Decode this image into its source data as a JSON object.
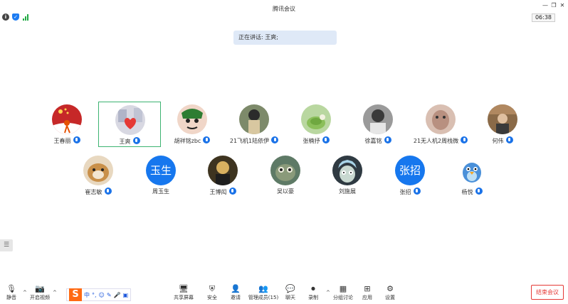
{
  "window": {
    "title": "腾讯会议"
  },
  "status": {
    "timer": "06:38"
  },
  "banner": {
    "text": "正在讲话: 王爽;"
  },
  "participants": [
    {
      "name": "王春丽",
      "avatar": "photo",
      "color": "#c62828",
      "active": false
    },
    {
      "name": "王爽",
      "avatar": "photo",
      "color": "#c9c9d6",
      "active": true
    },
    {
      "name": "胡祥铭zbc",
      "avatar": "photo",
      "color": "#d8a48f",
      "active": false
    },
    {
      "name": "21飞机1陆依伊",
      "avatar": "photo",
      "color": "#8a8a70",
      "active": false
    },
    {
      "name": "张楠抒",
      "avatar": "photo",
      "color": "#a6c98a",
      "active": false
    },
    {
      "name": "徐嘉铭",
      "avatar": "photo",
      "color": "#7a7a7a",
      "active": false
    },
    {
      "name": "21无人机2周栈微",
      "avatar": "photo",
      "color": "#c8a89a",
      "active": false
    },
    {
      "name": "何伟",
      "avatar": "photo",
      "color": "#9e7a52",
      "active": false
    },
    {
      "name": "崔志敏",
      "avatar": "photo",
      "color": "#caa070",
      "active": false
    },
    {
      "name": "周玉生",
      "avatar": "text",
      "initials": "玉生",
      "color": "#1677ee",
      "active": false
    },
    {
      "name": "王博闳",
      "avatar": "photo",
      "color": "#5a4a2a",
      "active": false
    },
    {
      "name": "吴以豪",
      "avatar": "photo",
      "color": "#6b8a6a",
      "active": false
    },
    {
      "name": "刘施展",
      "avatar": "photo",
      "color": "#44505a",
      "active": false
    },
    {
      "name": "张招",
      "avatar": "text",
      "initials": "张招",
      "color": "#1677ee",
      "active": false
    },
    {
      "name": "杨悦",
      "avatar": "photo",
      "color": "#ffffff",
      "active": false
    }
  ],
  "toolbar": {
    "mute": "静音",
    "video": "开启视频",
    "share": "共享屏幕",
    "security": "安全",
    "invite": "邀请",
    "members": "管理成员(15)",
    "chat": "聊天",
    "record": "录制",
    "breakout": "分组讨论",
    "apps": "应用",
    "settings": "设置",
    "end": "结束会议"
  },
  "ime": {
    "logo": "S",
    "mode": "中"
  },
  "colors": {
    "accent": "#1677ee",
    "active_border": "#3cb371",
    "end": "#e53935"
  }
}
